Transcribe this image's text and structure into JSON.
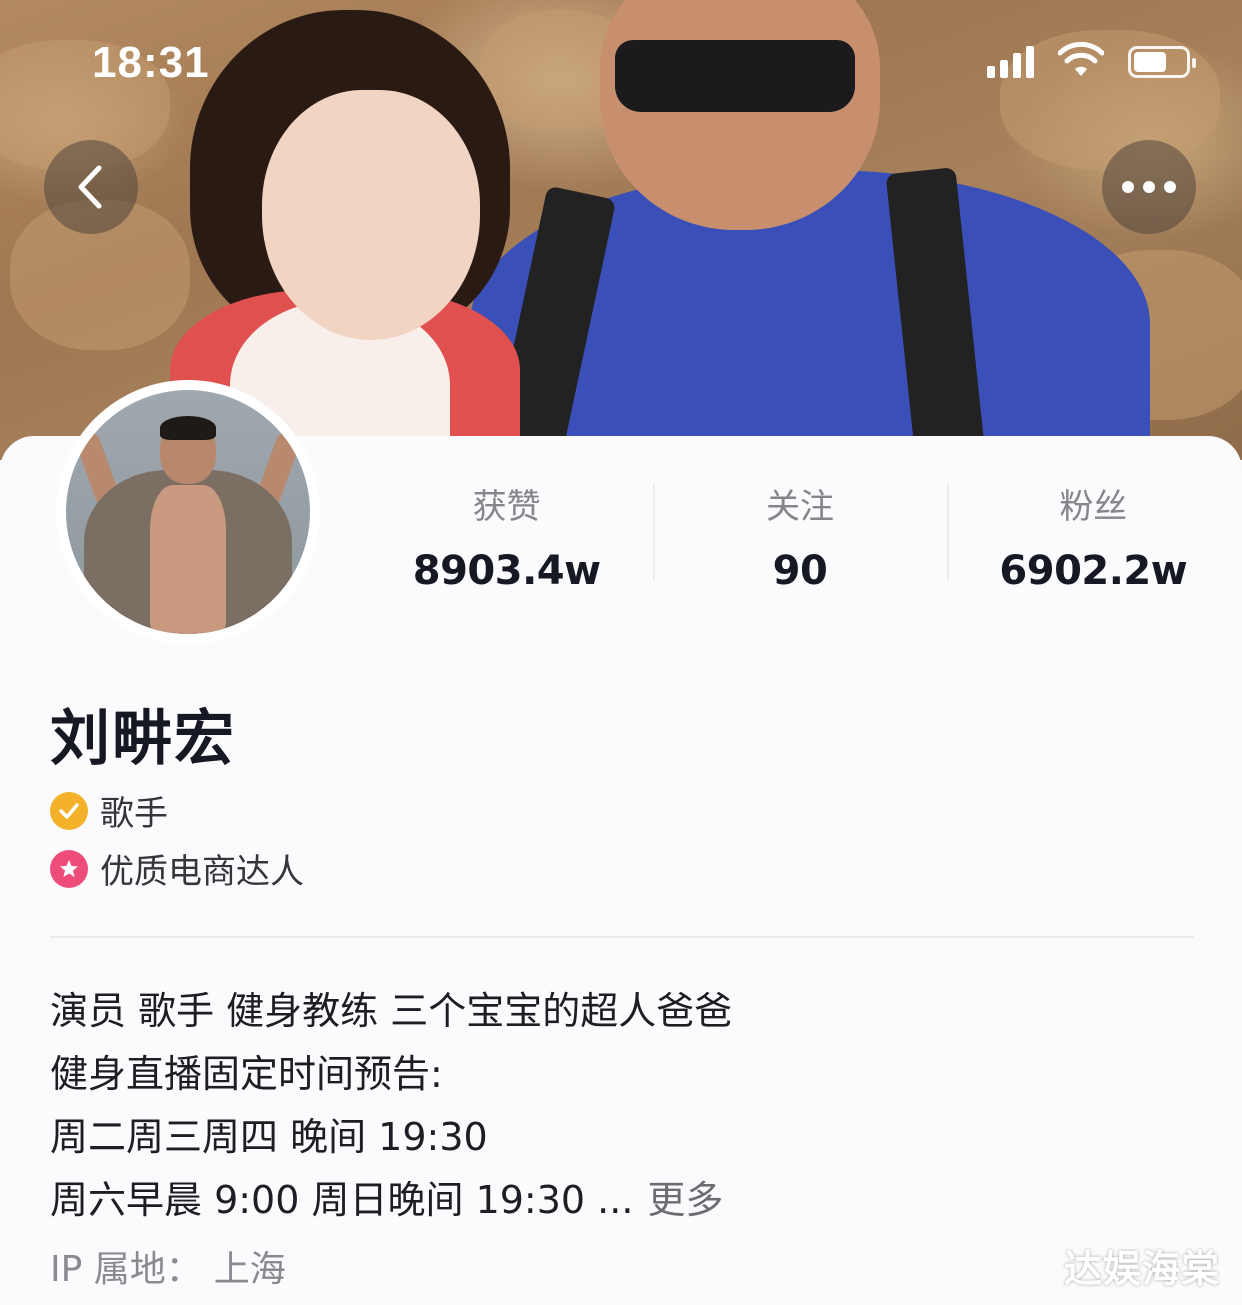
{
  "status_bar": {
    "time": "18:31"
  },
  "nav": {
    "back_icon": "chevron-left-icon",
    "more_icon": "ellipsis-icon"
  },
  "profile": {
    "name": "刘畊宏",
    "stats": [
      {
        "label": "获赞",
        "value": "8903.4w"
      },
      {
        "label": "关注",
        "value": "90"
      },
      {
        "label": "粉丝",
        "value": "6902.2w"
      }
    ],
    "tags": [
      {
        "icon": "verified-check-icon",
        "text": "歌手",
        "color": "#f3b22a"
      },
      {
        "icon": "star-badge-icon",
        "text": "优质电商达人",
        "color": "#ee4d7a"
      }
    ],
    "bio": [
      "演员 歌手 健身教练 三个宝宝的超人爸爸",
      "健身直播固定时间预告:",
      "周二周三周四 晚间 19:30",
      "周六早晨 9:00 周日晚间 19:30 ..."
    ],
    "more_label": "更多",
    "ip_label": "IP 属地：",
    "ip_value": "上海"
  },
  "watermark": "达娱海棠"
}
